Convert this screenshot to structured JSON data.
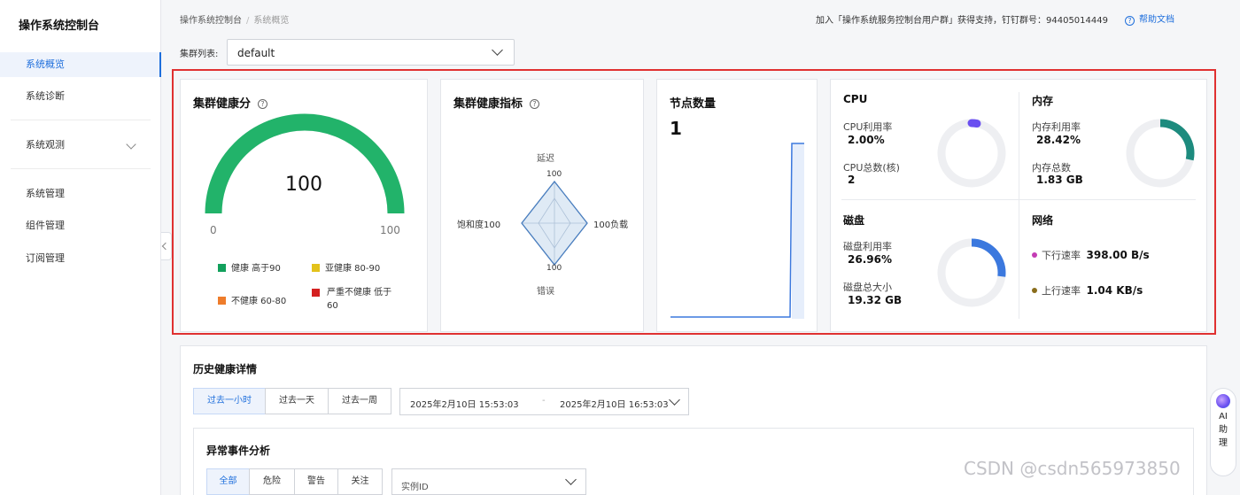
{
  "sidebar": {
    "title": "操作系统控制台",
    "items": [
      {
        "label": "系统概览",
        "active": true
      },
      {
        "label": "系统诊断"
      },
      {
        "label": "系统观测"
      },
      {
        "label": "系统管理"
      },
      {
        "label": "组件管理"
      },
      {
        "label": "订阅管理"
      }
    ]
  },
  "breadcrumb": {
    "root": "操作系统控制台",
    "current": "系统概览"
  },
  "top_info": "加入「操作系统服务控制台用户群」获得支持，钉钉群号：94405014449",
  "help_label": "帮助文档",
  "cluster": {
    "label": "集群列表:",
    "value": "default"
  },
  "health": {
    "title": "集群健康分",
    "score": "100",
    "score_value": 100,
    "min": "0",
    "max": "100",
    "legend": [
      {
        "label": "健康 高于90",
        "color": "#12a05c"
      },
      {
        "label": "亚健康 80-90",
        "color": "#e3c21b"
      },
      {
        "label": "不健康 60-80",
        "color": "#ee7c2b"
      },
      {
        "label": "严重不健康 低于60",
        "color": "#d42020"
      }
    ]
  },
  "metrics": {
    "title": "集群健康指标",
    "axes": {
      "top_label": "延迟",
      "top_value": "100",
      "right_label": "负载",
      "right_value": "100",
      "bottom_label": "错误",
      "bottom_value": "100",
      "left_label": "饱和度",
      "left_value": "100"
    }
  },
  "nodes": {
    "title": "节点数量",
    "count": "1"
  },
  "resources": {
    "cpu": {
      "title": "CPU",
      "usage_label": "CPU利用率",
      "usage": "2.00%",
      "usage_value": 2.0,
      "total_label": "CPU总数(核)",
      "total": "2",
      "color": "#6a4ff0"
    },
    "memory": {
      "title": "内存",
      "usage_label": "内存利用率",
      "usage": "28.42%",
      "usage_value": 28.42,
      "total_label": "内存总数",
      "total": "1.83 GB",
      "color": "#1d8b7e"
    },
    "disk": {
      "title": "磁盘",
      "usage_label": "磁盘利用率",
      "usage": "26.96%",
      "usage_value": 26.96,
      "total_label": "磁盘总大小",
      "total": "19.32 GB",
      "color": "#3b78de"
    },
    "network": {
      "title": "网络",
      "down_label": "下行速率",
      "down": "398.00 B/s",
      "down_color": "#c43cb4",
      "up_label": "上行速率",
      "up": "1.04 KB/s",
      "up_color": "#8a6d1c"
    }
  },
  "history": {
    "title": "历史健康详情",
    "ranges": [
      "过去一小时",
      "过去一天",
      "过去一周"
    ],
    "start": "2025年2月10日 15:53:03",
    "dash": "-",
    "end": "2025年2月10日 16:53:03"
  },
  "anomaly": {
    "title": "异常事件分析",
    "filters": [
      "全部",
      "危险",
      "警告",
      "关注"
    ],
    "instance_placeholder": "实例ID"
  },
  "ai": {
    "label_1": "AI",
    "label_2": "助",
    "label_3": "理"
  },
  "watermark": "CSDN @csdn565973850"
}
